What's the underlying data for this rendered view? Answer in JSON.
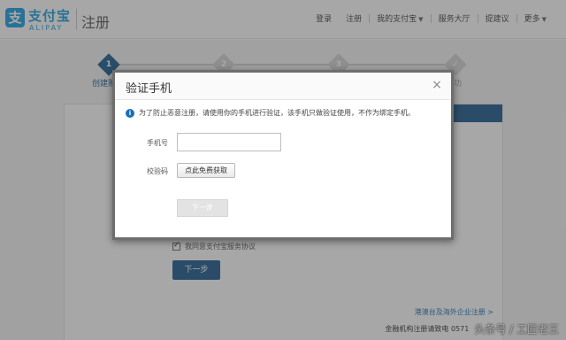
{
  "header": {
    "logo_mark": "支",
    "logo_cn": "支付宝",
    "logo_en": "ALIPAY",
    "page_name": "注册",
    "nav": [
      {
        "label": "登录",
        "dropdown": false
      },
      {
        "label": "注册",
        "dropdown": false
      },
      {
        "label": "我的支付宝",
        "dropdown": true
      },
      {
        "label": "服务大厅",
        "dropdown": false
      },
      {
        "label": "提建议",
        "dropdown": false
      },
      {
        "label": "更多",
        "dropdown": true
      }
    ]
  },
  "steps": [
    {
      "num": "1",
      "label": "创建账",
      "state": "active"
    },
    {
      "num": "2",
      "label": "",
      "state": "pending"
    },
    {
      "num": "3",
      "label": "",
      "state": "pending"
    },
    {
      "num": "✓",
      "label": "成功",
      "state": "pending"
    }
  ],
  "background_form": {
    "agree_text": "我同意支付宝服务协议",
    "next_label": "下一步",
    "bottom_link": "港澳台及海外企业注册 >",
    "footer_text": "金融机构注册请致电 0571",
    "watermark": "头条号 / 工匠老王"
  },
  "dialog": {
    "title": "验证手机",
    "close": "×",
    "notice_icon": "i",
    "notice": "为了防止恶意注册，请使用你的手机进行验证，该手机只做验证使用，不作为绑定手机。",
    "phone_label": "手机号",
    "phone_value": "",
    "phone_placeholder": "",
    "code_label": "校验码",
    "code_button": "点此免费获取",
    "next_button": "下一步"
  },
  "colors": {
    "brand": "#1a9fe0",
    "primary_button": "#1e5a8e",
    "overlay": "rgba(60,60,60,0.45)"
  }
}
